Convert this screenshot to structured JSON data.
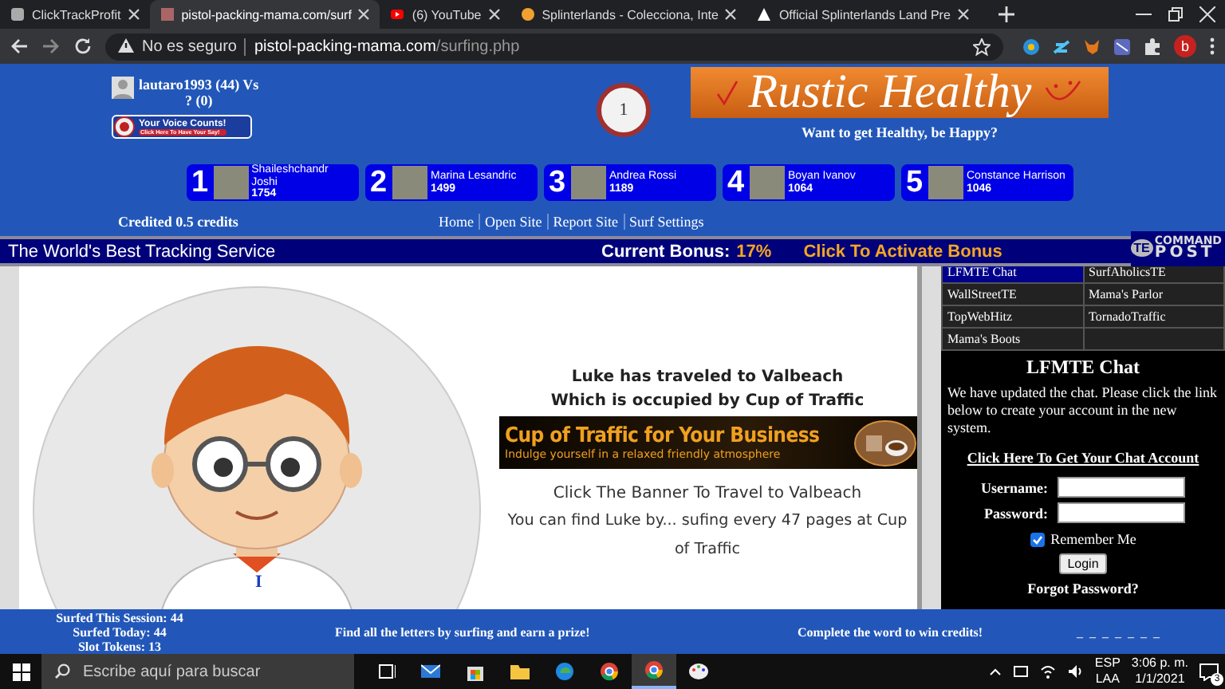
{
  "browser": {
    "tabs": [
      {
        "title": "ClickTrackProfit",
        "selected": false
      },
      {
        "title": "pistol-packing-mama.com/surf",
        "selected": true
      },
      {
        "title": "(6) YouTube",
        "selected": false
      },
      {
        "title": "Splinterlands - Colecciona, Inte",
        "selected": false
      },
      {
        "title": "Official Splinterlands Land Pre",
        "selected": false
      }
    ],
    "security": "No es seguro",
    "url_host": "pistol-packing-mama.com",
    "url_path": "/surfing.php",
    "profile": "b"
  },
  "header": {
    "user": "lautaro1993 (44) Vs",
    "opponent": "? (0)",
    "voice_badge": {
      "title": "Your Voice Counts!",
      "subtitle": "Click Here To Have Your Say!"
    },
    "leaders": [
      {
        "rank": "1",
        "name": "Shaileshchandr Joshi",
        "score": "1754"
      },
      {
        "rank": "2",
        "name": "Marina Lesandric",
        "score": "1499"
      },
      {
        "rank": "3",
        "name": "Andrea Rossi",
        "score": "1189"
      },
      {
        "rank": "4",
        "name": "Boyan Ivanov",
        "score": "1064"
      },
      {
        "rank": "5",
        "name": "Constance Harrison",
        "score": "1046"
      }
    ],
    "timer": "1",
    "banner_title": "Rustic Healthy",
    "tagline": "Want to get Healthy, be Happy?",
    "credited": "Credited 0.5 credits",
    "nav": [
      "Home",
      "Open Site",
      "Report Site",
      "Surf Settings"
    ]
  },
  "bonus_bar": {
    "slogan": "The World's Best Tracking Service",
    "bonus_label": "Current Bonus:",
    "bonus_value": "17%",
    "activate": "Click To Activate Bonus",
    "logo_badge": "TE",
    "logo_top": "COMMAND",
    "logo_bottom": "POST"
  },
  "main": {
    "letter": "I",
    "heading": "Luke has traveled to Valbeach",
    "occupied": "Which is occupied by Cup of Traffic",
    "ad": {
      "title": "Cup of Traffic for Your Business",
      "subtitle": "Indulge yourself in a relaxed friendly atmosphere"
    },
    "instruction": "Click The Banner To Travel to Valbeach",
    "hint": "You can find Luke by... sufing every 47 pages at Cup of Traffic"
  },
  "sidebar": {
    "sites": [
      {
        "name": "LFMTE Chat",
        "selected": true
      },
      {
        "name": "SurfAholicsTE",
        "selected": false
      },
      {
        "name": "WallStreetTE",
        "selected": false
      },
      {
        "name": "Mama's Parlor",
        "selected": false
      },
      {
        "name": "TopWebHitz",
        "selected": false
      },
      {
        "name": "TornadoTraffic",
        "selected": false
      },
      {
        "name": "Mama's Boots",
        "selected": false
      }
    ],
    "chat": {
      "title": "LFMTE Chat",
      "message": "We have updated the chat. Please click the link below to create your account in the new system.",
      "link": "Click Here To Get Your Chat Account",
      "username_label": "Username:",
      "password_label": "Password:",
      "remember": {
        "label": "Remember Me",
        "checked": true
      },
      "login": "Login",
      "forgot": "Forgot Password?"
    }
  },
  "footer": {
    "stats": [
      "Surfed This Session: 44",
      "Surfed Today: 44",
      "Slot Tokens: 13"
    ],
    "prize": "Find all the letters by surfing and earn a prize!",
    "complete": "Complete the word to win credits!",
    "word": "_ _ _ _ _ _ _"
  },
  "taskbar": {
    "search_placeholder": "Escribe aquí para buscar",
    "language": "ESP",
    "layout": "LAA",
    "time": "3:06 p. m.",
    "date": "1/1/2021",
    "notifications": "3"
  }
}
